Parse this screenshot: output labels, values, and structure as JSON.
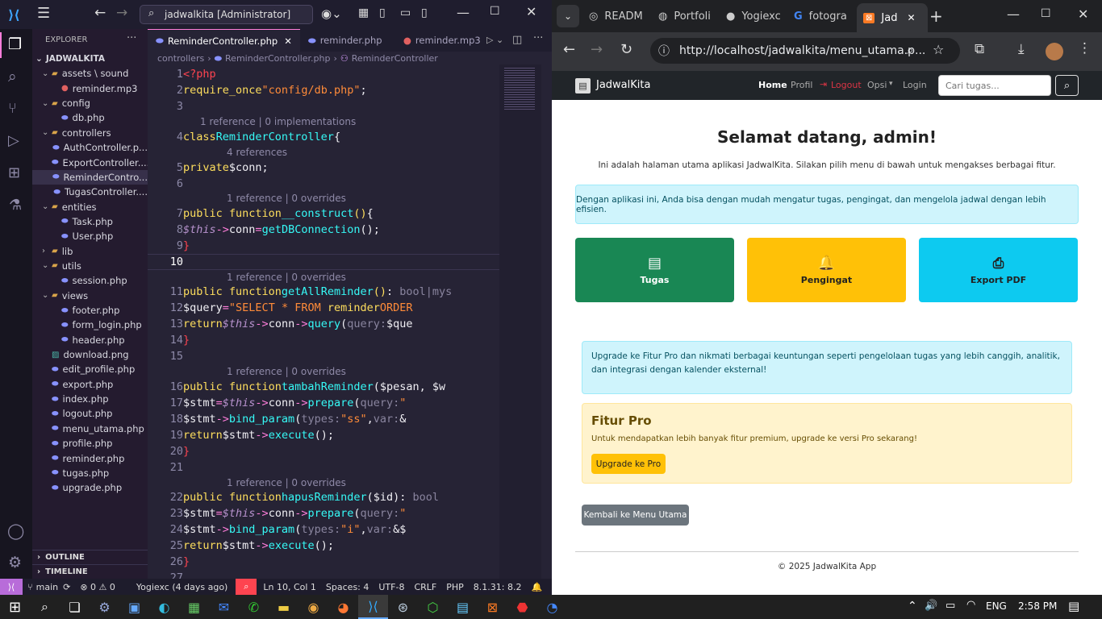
{
  "vscode": {
    "search_text": "jadwalkita [Administrator]",
    "explorer_title": "EXPLORER",
    "root_folder": "JADWALKITA",
    "tree": [
      {
        "label": "assets \\ sound",
        "kind": "folder",
        "depth": 1,
        "open": true
      },
      {
        "label": "reminder.mp3",
        "kind": "mp3",
        "depth": 2
      },
      {
        "label": "config",
        "kind": "folder",
        "depth": 1,
        "open": true
      },
      {
        "label": "db.php",
        "kind": "php",
        "depth": 2
      },
      {
        "label": "controllers",
        "kind": "folder",
        "depth": 1,
        "open": true
      },
      {
        "label": "AuthController.p...",
        "kind": "php",
        "depth": 2
      },
      {
        "label": "ExportController....",
        "kind": "php",
        "depth": 2
      },
      {
        "label": "ReminderContro...",
        "kind": "php",
        "depth": 2,
        "selected": true
      },
      {
        "label": "TugasController....",
        "kind": "php",
        "depth": 2
      },
      {
        "label": "entities",
        "kind": "folder",
        "depth": 1,
        "open": true
      },
      {
        "label": "Task.php",
        "kind": "php",
        "depth": 2
      },
      {
        "label": "User.php",
        "kind": "php",
        "depth": 2
      },
      {
        "label": "lib",
        "kind": "folder",
        "depth": 1,
        "open": false
      },
      {
        "label": "utils",
        "kind": "folder",
        "depth": 1,
        "open": true
      },
      {
        "label": "session.php",
        "kind": "php",
        "depth": 2
      },
      {
        "label": "views",
        "kind": "folder",
        "depth": 1,
        "open": true
      },
      {
        "label": "footer.php",
        "kind": "php",
        "depth": 2
      },
      {
        "label": "form_login.php",
        "kind": "php",
        "depth": 2
      },
      {
        "label": "header.php",
        "kind": "php",
        "depth": 2
      },
      {
        "label": "download.png",
        "kind": "png",
        "depth": 1
      },
      {
        "label": "edit_profile.php",
        "kind": "php",
        "depth": 1
      },
      {
        "label": "export.php",
        "kind": "php",
        "depth": 1
      },
      {
        "label": "index.php",
        "kind": "php",
        "depth": 1
      },
      {
        "label": "logout.php",
        "kind": "php",
        "depth": 1
      },
      {
        "label": "menu_utama.php",
        "kind": "php",
        "depth": 1
      },
      {
        "label": "profile.php",
        "kind": "php",
        "depth": 1
      },
      {
        "label": "reminder.php",
        "kind": "php",
        "depth": 1
      },
      {
        "label": "tugas.php",
        "kind": "php",
        "depth": 1
      },
      {
        "label": "upgrade.php",
        "kind": "php",
        "depth": 1
      }
    ],
    "outline_label": "OUTLINE",
    "timeline_label": "TIMELINE",
    "tabs": [
      {
        "label": "ReminderController.php",
        "active": true
      },
      {
        "label": "reminder.php",
        "active": false
      },
      {
        "label": "reminder.mp3",
        "active": false
      }
    ],
    "breadcrumb": [
      "controllers",
      "ReminderController.php",
      "ReminderController"
    ],
    "lens": {
      "l1": "1 reference | 0 implementations",
      "l2": "4 references",
      "l3": "1 reference | 0 overrides",
      "l4": "1 reference | 0 overrides",
      "l5": "1 reference | 0 overrides",
      "l6": "1 reference | 0 overrides"
    },
    "status": {
      "branch": "main",
      "problems": "⊗ 0 ⚠ 0",
      "blame": "Yogiexc (4 days ago)",
      "position": "Ln 10, Col 1",
      "spaces": "Spaces: 4",
      "encoding": "UTF-8",
      "eol": "CRLF",
      "language": "PHP",
      "php_version": "8.1.31: 8.2"
    }
  },
  "browser": {
    "tabs": [
      "READM",
      "Portfoli",
      "Yogiexc",
      "fotogra",
      "Jad"
    ],
    "url": "http://localhost/jadwalkita/menu_utama.p...",
    "brand": "JadwalKita",
    "nav": [
      "Home",
      "Profil",
      "Logout",
      "Opsi",
      "Login"
    ],
    "search_placeholder": "Cari tugas...",
    "heading": "Selamat datang, admin!",
    "intro": "Ini adalah halaman utama aplikasi JadwalKita. Silakan pilih menu di bawah untuk mengakses berbagai fitur.",
    "info_box": "Dengan aplikasi ini, Anda bisa dengan mudah mengatur tugas, pengingat, dan mengelola jadwal dengan lebih efisien.",
    "cards": [
      "Tugas",
      "Pengingat",
      "Export PDF"
    ],
    "upgrade_info": "Upgrade ke Fitur Pro dan nikmati berbagai keuntungan seperti pengelolaan tugas yang lebih canggih, analitik, dan integrasi dengan kalender eksternal!",
    "pro_title": "Fitur Pro",
    "pro_text": "Untuk mendapatkan lebih banyak fitur premium, upgrade ke versi Pro sekarang!",
    "pro_button": "Upgrade ke Pro",
    "back_button": "Kembali ke Menu Utama",
    "footer": "© 2025 JadwalKita App"
  },
  "taskbar": {
    "language": "ENG",
    "time": "2:58 PM"
  },
  "colors": {
    "card_green": "#198754",
    "card_yellow": "#ffc107",
    "card_cyan": "#0dcaf0",
    "navbar": "#212529",
    "logout_red": "#dc3545"
  }
}
